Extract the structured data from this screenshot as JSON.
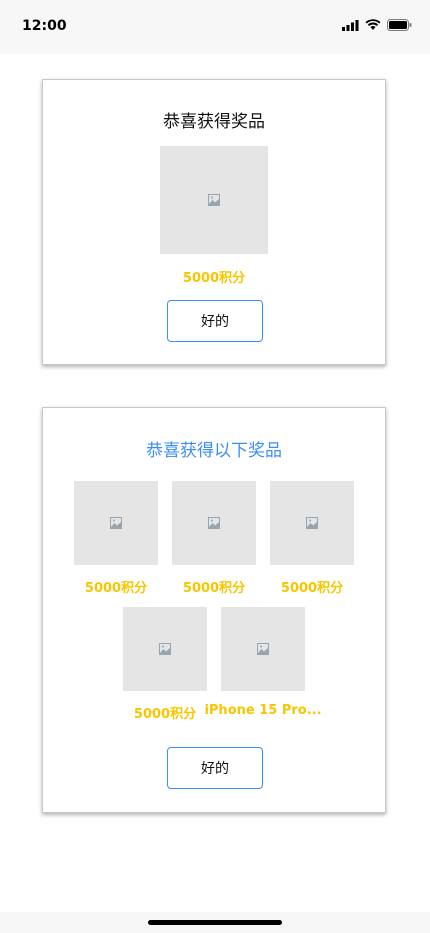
{
  "status_bar": {
    "time": "12:00"
  },
  "dialog_single": {
    "title": "恭喜获得奖品",
    "prize_label": "5000积分",
    "ok_label": "好的"
  },
  "dialog_multi": {
    "title": "恭喜获得以下奖品",
    "title_color": "#3a8ef6",
    "prizes": [
      {
        "label": "5000积分"
      },
      {
        "label": "5000积分"
      },
      {
        "label": "5000积分"
      },
      {
        "label": "5000积分"
      },
      {
        "label": "iPhone 15 Pro..."
      }
    ],
    "ok_label": "好的"
  },
  "colors": {
    "accent": "#3a8ef6",
    "points": "#f7c600"
  }
}
